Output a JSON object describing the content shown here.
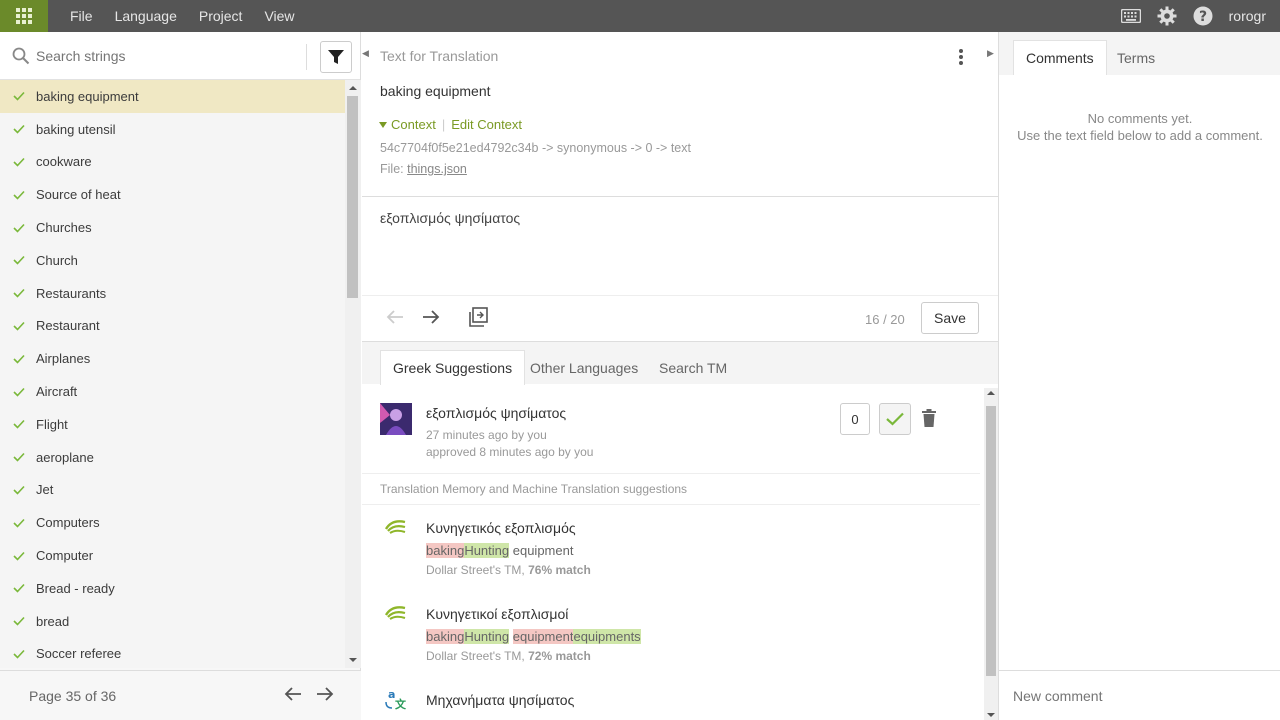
{
  "topbar": {
    "menu": [
      "File",
      "Language",
      "Project",
      "View"
    ],
    "username": "rorogr"
  },
  "search": {
    "placeholder": "Search strings"
  },
  "strings": [
    "baking equipment",
    "baking utensil",
    "cookware",
    "Source of heat",
    "Churches",
    "Church",
    "Restaurants",
    "Restaurant",
    "Airplanes",
    "Aircraft",
    "Flight",
    "aeroplane",
    "Jet",
    "Computers",
    "Computer",
    "Bread - ready",
    "bread",
    "Soccer referee"
  ],
  "pager": {
    "label": "Page 35 of 36"
  },
  "editor": {
    "header": "Text for Translation",
    "source": "baking equipment",
    "context_label": "Context",
    "edit_context_label": "Edit Context",
    "context_path": "54c7704f0f5e21ed4792c34b -> synonymous -> 0 -> text",
    "file_prefix": "File:",
    "file_name": "things.json",
    "translation": "εξοπλισμός ψησίματος",
    "char_count": "16 / 20",
    "save_label": "Save"
  },
  "tabs": [
    "Greek Suggestions",
    "Other Languages",
    "Search TM"
  ],
  "suggestion": {
    "text": "εξοπλισμός ψησίματος",
    "meta1": "27 minutes ago by you",
    "meta2": "approved 8 minutes ago by you",
    "votes": "0"
  },
  "tm_header": "Translation Memory and Machine Translation suggestions",
  "tm": [
    {
      "text": "Κυνηγετικός εξοπλισμός",
      "del1": "baking",
      "ins1": "Hunting",
      "rest1": " equipment",
      "source_name": "Dollar Street's TM, ",
      "match": "76% match"
    },
    {
      "text": "Κυνηγετικοί εξοπλισμοί",
      "del1": "baking",
      "ins1": "Hunting",
      "space": " ",
      "del2": "equipment",
      "ins2": "equipments",
      "source_name": "Dollar Street's TM, ",
      "match": "72% match"
    },
    {
      "text": "Μηχανήματα ψησίματος"
    }
  ],
  "right": {
    "tabs": [
      "Comments",
      "Terms"
    ],
    "no_comments_1": "No comments yet.",
    "no_comments_2": "Use the text field below to add a comment.",
    "new_comment_placeholder": "New comment"
  },
  "colors": {
    "accent": "#6b8a2a",
    "topbar": "#555555",
    "active_row": "#f0e8c4"
  }
}
